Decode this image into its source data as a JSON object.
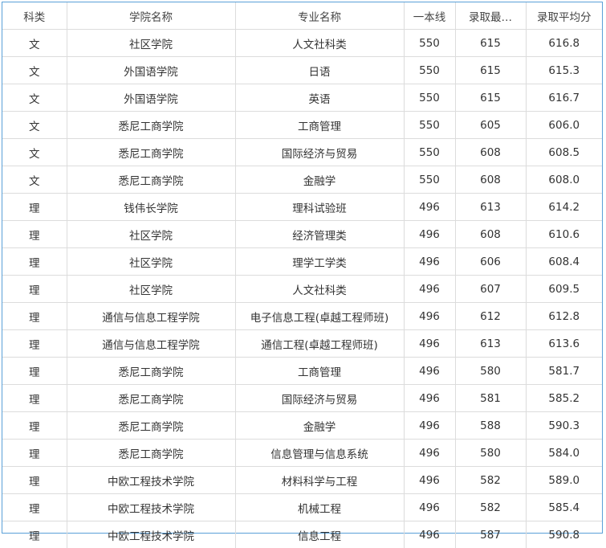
{
  "table": {
    "headers": [
      "科类",
      "学院名称",
      "专业名称",
      "一本线",
      "录取最…",
      "录取平均分"
    ],
    "rows": [
      [
        "文",
        "社区学院",
        "人文社科类",
        "550",
        "615",
        "616.8"
      ],
      [
        "文",
        "外国语学院",
        "日语",
        "550",
        "615",
        "615.3"
      ],
      [
        "文",
        "外国语学院",
        "英语",
        "550",
        "615",
        "616.7"
      ],
      [
        "文",
        "悉尼工商学院",
        "工商管理",
        "550",
        "605",
        "606.0"
      ],
      [
        "文",
        "悉尼工商学院",
        "国际经济与贸易",
        "550",
        "608",
        "608.5"
      ],
      [
        "文",
        "悉尼工商学院",
        "金融学",
        "550",
        "608",
        "608.0"
      ],
      [
        "理",
        "钱伟长学院",
        "理科试验班",
        "496",
        "613",
        "614.2"
      ],
      [
        "理",
        "社区学院",
        "经济管理类",
        "496",
        "608",
        "610.6"
      ],
      [
        "理",
        "社区学院",
        "理学工学类",
        "496",
        "606",
        "608.4"
      ],
      [
        "理",
        "社区学院",
        "人文社科类",
        "496",
        "607",
        "609.5"
      ],
      [
        "理",
        "通信与信息工程学院",
        "电子信息工程(卓越工程师班)",
        "496",
        "612",
        "612.8"
      ],
      [
        "理",
        "通信与信息工程学院",
        "通信工程(卓越工程师班)",
        "496",
        "613",
        "613.6"
      ],
      [
        "理",
        "悉尼工商学院",
        "工商管理",
        "496",
        "580",
        "581.7"
      ],
      [
        "理",
        "悉尼工商学院",
        "国际经济与贸易",
        "496",
        "581",
        "585.2"
      ],
      [
        "理",
        "悉尼工商学院",
        "金融学",
        "496",
        "588",
        "590.3"
      ],
      [
        "理",
        "悉尼工商学院",
        "信息管理与信息系统",
        "496",
        "580",
        "584.0"
      ],
      [
        "理",
        "中欧工程技术学院",
        "材料科学与工程",
        "496",
        "582",
        "589.0"
      ],
      [
        "理",
        "中欧工程技术学院",
        "机械工程",
        "496",
        "582",
        "585.4"
      ],
      [
        "理",
        "中欧工程技术学院",
        "信息工程",
        "496",
        "587",
        "590.8"
      ]
    ]
  },
  "colors": {
    "frame_border": "#5aa0d8",
    "grid": "#dcdcdc",
    "text": "#333333"
  }
}
